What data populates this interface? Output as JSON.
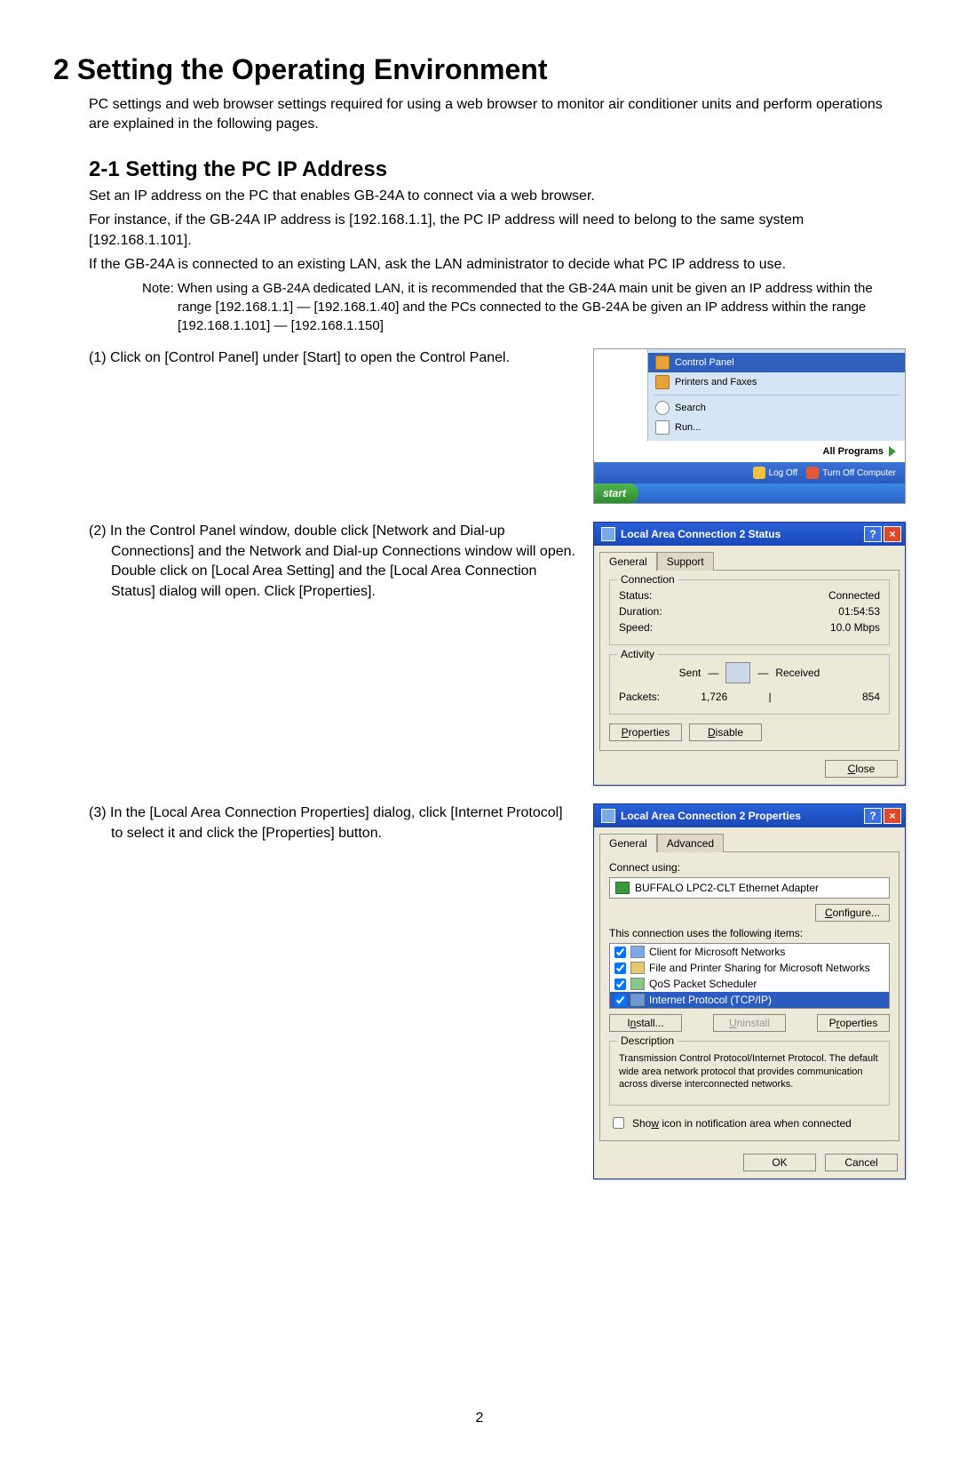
{
  "h1": "2 Setting the Operating Environment",
  "intro": "PC settings and web browser settings required for using a web browser to monitor air conditioner units and perform operations are explained in the following pages.",
  "h2": "2-1 Setting the PC IP Address",
  "p1": "Set an IP address on the PC that enables GB-24A to connect via a web browser.",
  "p2": "For instance, if the GB-24A IP address is [192.168.1.1], the PC IP address will need to belong to the same system [192.168.1.101].",
  "p3": "If the GB-24A is connected to an existing LAN, ask the LAN administrator to decide what PC IP address to use.",
  "note": "Note: When using a GB-24A dedicated LAN, it is recommended that the GB-24A main unit be given an IP address within the range [192.168.1.1] — [192.168.1.40] and the PCs connected to the GB-24A be given an IP address within the range [192.168.1.101] — [192.168.1.150]",
  "step1": "(1) Click on [Control Panel] under [Start] to open the Control Panel.",
  "step2": "(2) In the Control Panel window, double click [Network and Dial-up Connections] and the Network and Dial-up Connections window will open. Double click on [Local Area Setting] and the [Local Area Connection Status] dialog will open. Click [Properties].",
  "step3": "(3) In the [Local Area Connection Properties] dialog, click [Internet Protocol] to select it and click the [Properties] button.",
  "startmenu": {
    "control_panel": "Control Panel",
    "printers": "Printers and Faxes",
    "search": "Search",
    "run": "Run...",
    "all_programs": "All Programs",
    "logoff": "Log Off",
    "turnoff": "Turn Off Computer",
    "start": "start"
  },
  "status_dialog": {
    "title": "Local Area Connection 2 Status",
    "tab_general": "General",
    "tab_support": "Support",
    "connection_legend": "Connection",
    "status_label": "Status:",
    "status_val": "Connected",
    "duration_label": "Duration:",
    "duration_val": "01:54:53",
    "speed_label": "Speed:",
    "speed_val": "10.0 Mbps",
    "activity_legend": "Activity",
    "sent": "Sent",
    "received": "Received",
    "packets_label": "Packets:",
    "packets_sent": "1,726",
    "packets_recv": "854",
    "properties_btn": "Properties",
    "disable_btn": "Disable",
    "close_btn": "Close"
  },
  "props_dialog": {
    "title": "Local Area Connection 2 Properties",
    "tab_general": "General",
    "tab_advanced": "Advanced",
    "connect_using": "Connect using:",
    "adapter": "BUFFALO LPC2-CLT Ethernet Adapter",
    "configure": "Configure...",
    "uses_items": "This connection uses the following items:",
    "item1": "Client for Microsoft Networks",
    "item2": "File and Printer Sharing for Microsoft Networks",
    "item3": "QoS Packet Scheduler",
    "item4": "Internet Protocol (TCP/IP)",
    "install": "Install...",
    "uninstall": "Uninstall",
    "properties": "Properties",
    "desc_legend": "Description",
    "desc_text": "Transmission Control Protocol/Internet Protocol. The default wide area network protocol that provides communication across diverse interconnected networks.",
    "show_icon": "Show icon in notification area when connected",
    "ok": "OK",
    "cancel": "Cancel"
  },
  "page_number": "2"
}
